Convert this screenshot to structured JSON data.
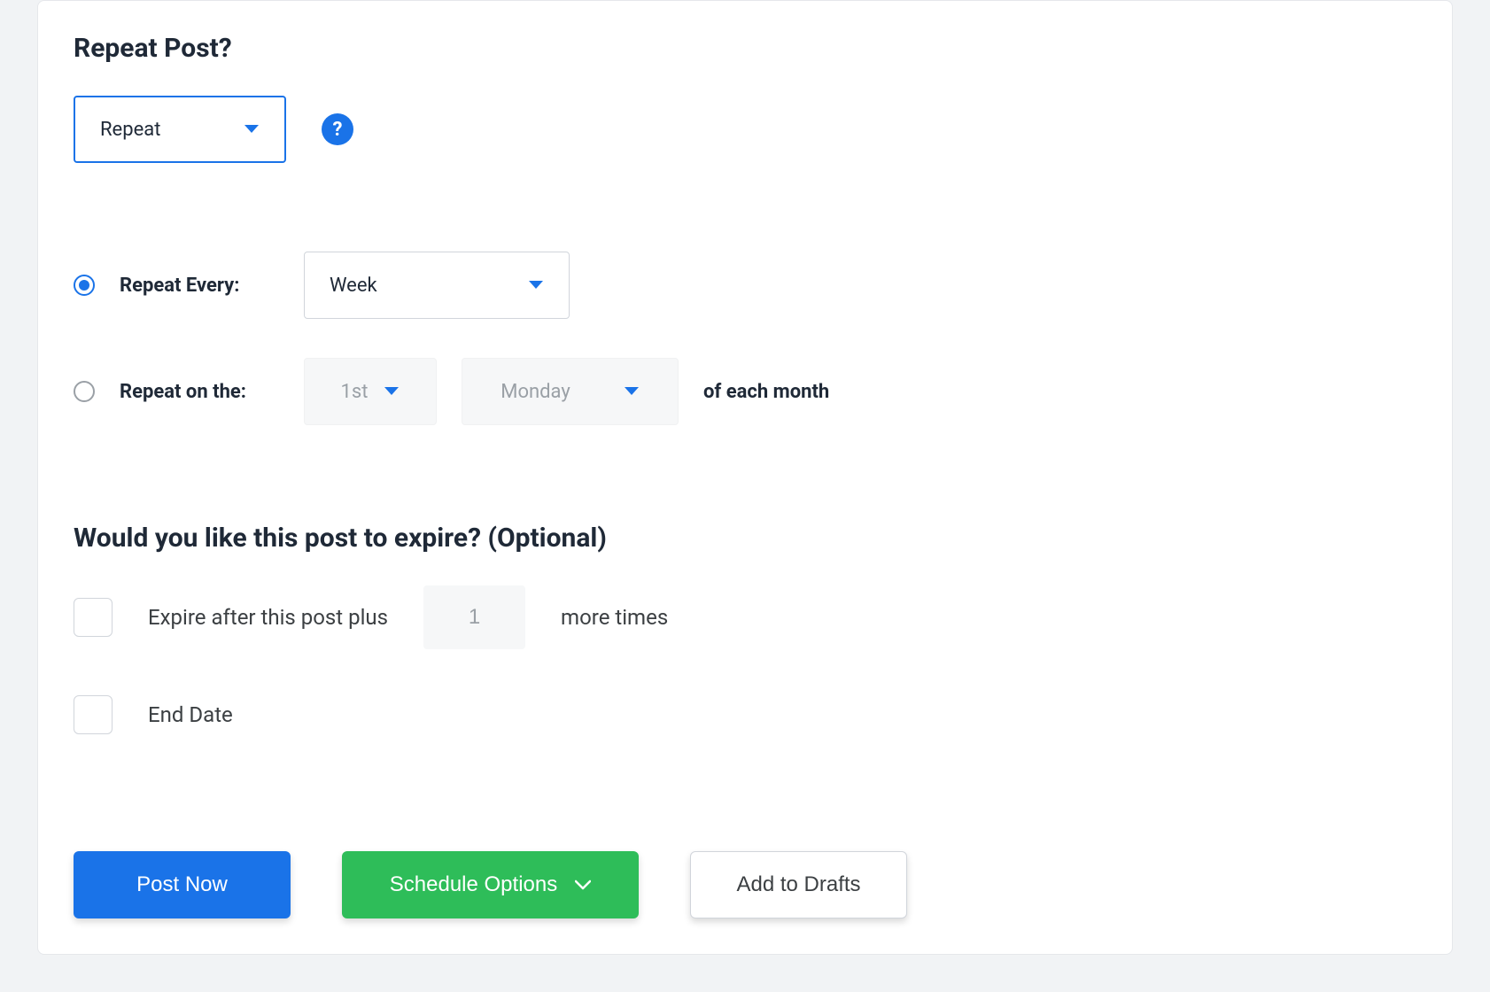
{
  "repeat": {
    "heading": "Repeat Post?",
    "select_label": "Repeat",
    "help_icon_label": "?",
    "every": {
      "radio_label": "Repeat Every:",
      "select_value": "Week",
      "checked": true
    },
    "on_the": {
      "radio_label": "Repeat on the:",
      "ordinal_value": "1st",
      "day_value": "Monday",
      "trailing_label": "of each month",
      "checked": false
    }
  },
  "expire": {
    "heading": "Would you like this post to expire? (Optional)",
    "after": {
      "label_before": "Expire after this post plus",
      "count_value": "1",
      "label_after": "more times"
    },
    "end_date": {
      "label": "End Date"
    }
  },
  "actions": {
    "post_now": "Post Now",
    "schedule_options": "Schedule Options",
    "add_to_drafts": "Add to Drafts"
  }
}
